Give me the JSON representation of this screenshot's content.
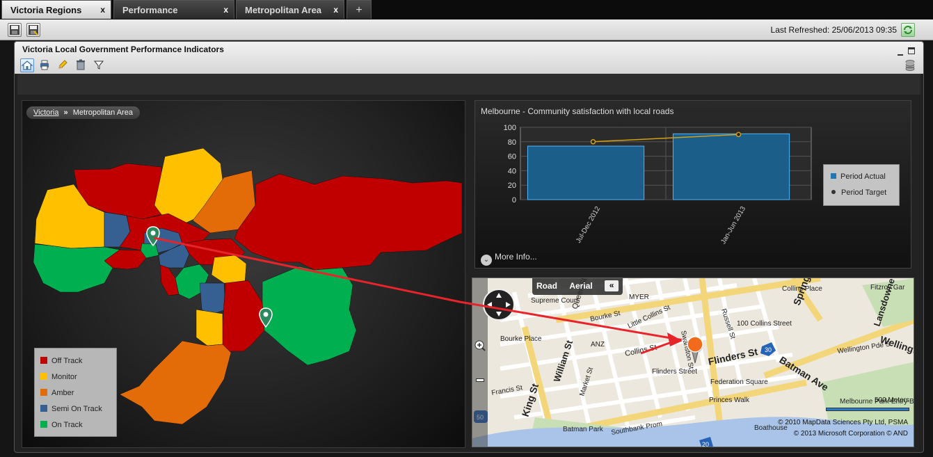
{
  "tabs": [
    {
      "label": "Victoria Regions",
      "active": true
    },
    {
      "label": "Performance",
      "active": false
    },
    {
      "label": "Metropolitan Area",
      "active": false
    }
  ],
  "tab_close_glyph": "x",
  "tab_add_glyph": "+",
  "toolbar": {
    "last_refreshed": "Last Refreshed: 25/06/2013 09:35",
    "icons": [
      "save-icon",
      "save-as-icon",
      "refresh-icon"
    ]
  },
  "panel": {
    "title": "Victoria Local Government Performance Indicators",
    "icons": [
      "home-icon",
      "print-icon",
      "edit-icon",
      "delete-icon",
      "filter-icon",
      "database-icon"
    ]
  },
  "breadcrumb": {
    "root": "Victoria",
    "separator": "»",
    "current": "Metropolitan Area"
  },
  "legend": [
    {
      "label": "Off Track",
      "color": "#c00000"
    },
    {
      "label": "Monitor",
      "color": "#ffc000"
    },
    {
      "label": "Amber",
      "color": "#e36c09"
    },
    {
      "label": "Semi On Track",
      "color": "#366092"
    },
    {
      "label": "On Track",
      "color": "#00b050"
    }
  ],
  "chart": {
    "title": "Melbourne - Community satisfaction with local roads",
    "legend_actual": "Period Actual",
    "legend_target": "Period Target",
    "more_info": "More Info...",
    "more_info_glyph": "⌄"
  },
  "chart_data": {
    "type": "bar",
    "categories": [
      "Jul-Dec 2012",
      "Jan-Jun 2013"
    ],
    "series": [
      {
        "name": "Period Actual",
        "type": "bar",
        "values": [
          74,
          91
        ],
        "color": "#1f77b4"
      },
      {
        "name": "Period Target",
        "type": "line",
        "values": [
          80,
          90
        ],
        "color": "#d4a017"
      }
    ],
    "yticks": [
      0,
      20,
      40,
      60,
      80,
      100
    ],
    "ylim": [
      0,
      100
    ],
    "grid": true,
    "legend": "right"
  },
  "street_map": {
    "mode_road": "Road",
    "mode_aerial": "Aerial",
    "collapse_glyph": "«",
    "scale": "500 Meters",
    "copyright1": "© 2010 MapData Sciences Pty Ltd, PSMA",
    "copyright2": "© 2013 Microsoft Corporation  © AND",
    "labels": [
      "Queen St",
      "Bourke St",
      "Collins St",
      "Flinders St",
      "William St",
      "King St",
      "Market St",
      "Russell St",
      "Spring St",
      "Batman Ave",
      "Wellington Pde S",
      "Little Collins St",
      "Swanston St",
      "Supreme Court",
      "Bourke Place",
      "MYER",
      "ANZ",
      "Flinders Street",
      "Federation Square",
      "Princes Walk",
      "Collins Place",
      "100 Collins Street",
      "Fitzroy Gar",
      "Lansdowne",
      "Wellingt",
      "Francis St",
      "Batman Park",
      "Southbank Prom",
      "Boathouse",
      "Melbourne Park-Entry B",
      "30",
      "20",
      "50"
    ]
  }
}
